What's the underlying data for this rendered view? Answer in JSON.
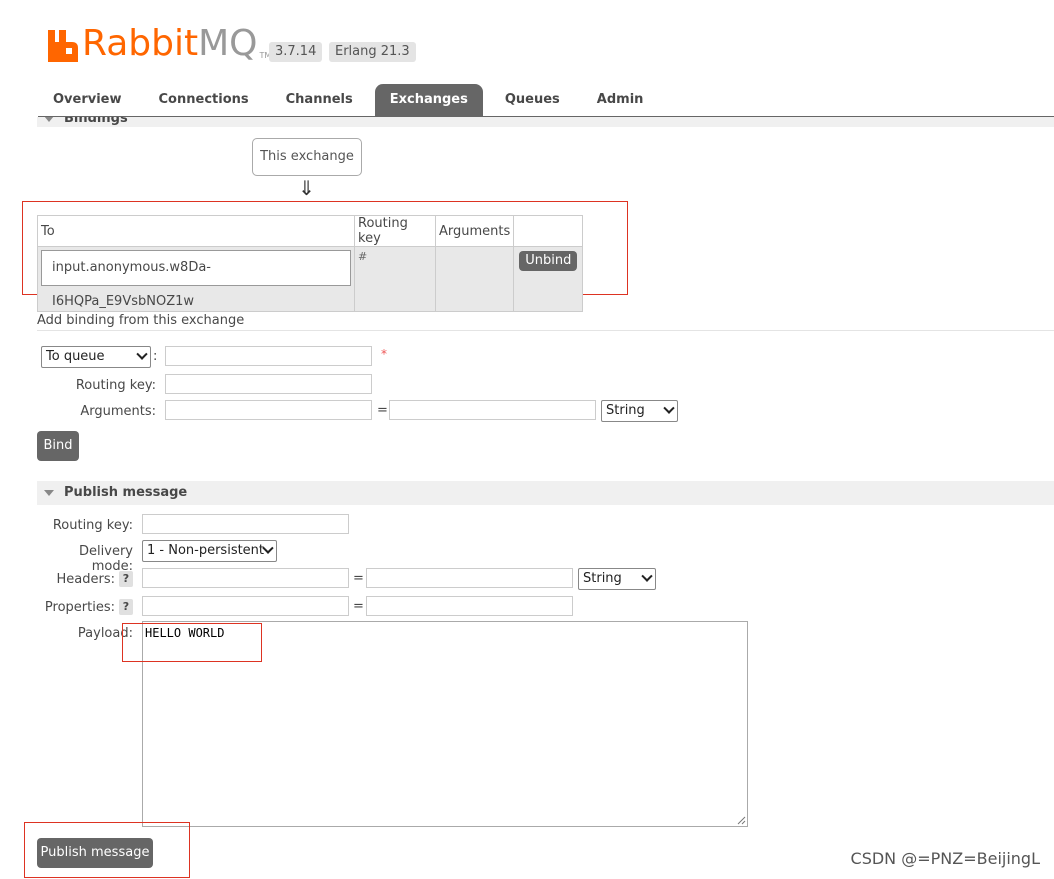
{
  "header": {
    "brand_rabbit": "Rabbit",
    "brand_mq": "MQ",
    "brand_tm": "TM",
    "version": "3.7.14",
    "erlang": "Erlang 21.3"
  },
  "nav": {
    "tabs": [
      {
        "label": "Overview",
        "active": false
      },
      {
        "label": "Connections",
        "active": false
      },
      {
        "label": "Channels",
        "active": false
      },
      {
        "label": "Exchanges",
        "active": true
      },
      {
        "label": "Queues",
        "active": false
      },
      {
        "label": "Admin",
        "active": false
      }
    ]
  },
  "bindings": {
    "section_title": "Bindings",
    "this_exchange": "This exchange",
    "arrow": "⇓",
    "table": {
      "headers": [
        "To",
        "Routing key",
        "Arguments",
        ""
      ],
      "rows": [
        {
          "to": "input.anonymous.w8Da-I6HQPa_E9VsbNOZ1w",
          "routing_key": "#",
          "arguments": "",
          "action": "Unbind"
        }
      ]
    }
  },
  "add_binding": {
    "title": "Add binding from this exchange",
    "destination_type": "To queue",
    "required_mark": "*",
    "colon": ":",
    "routing_key_label": "Routing key:",
    "arguments_label": "Arguments:",
    "equals": "=",
    "arg_type": "String",
    "bind_label": "Bind"
  },
  "publish": {
    "section_title": "Publish message",
    "routing_key_label": "Routing key:",
    "delivery_mode_label": "Delivery mode:",
    "delivery_mode_value": "1 - Non-persistent",
    "headers_label": "Headers:",
    "properties_label": "Properties:",
    "help": "?",
    "equals": "=",
    "headers_type": "String",
    "payload_label": "Payload:",
    "payload_value": "HELLO WORLD",
    "publish_label": "Publish message"
  },
  "watermark": "CSDN @=PNZ=BeijingL",
  "colors": {
    "brand_orange": "#ff6600",
    "brand_gray": "#999999",
    "active_tab": "#666666",
    "highlight_red": "#dd3322"
  }
}
